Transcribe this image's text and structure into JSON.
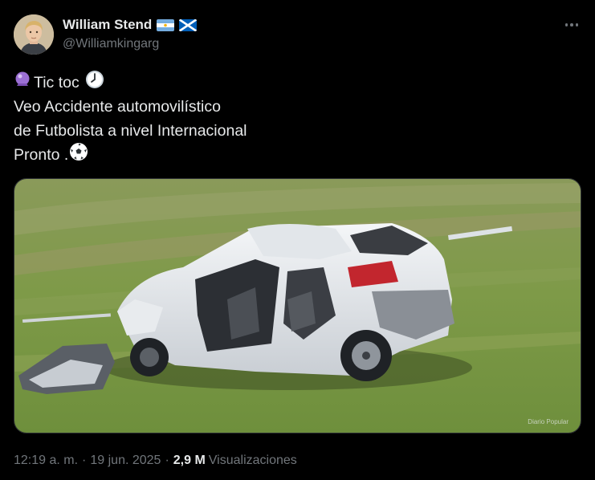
{
  "author": {
    "display_name": "William Stend",
    "handle": "@Williamkingarg",
    "flags": [
      "argentina-flag",
      "scotland-flag"
    ]
  },
  "tweet": {
    "lines": [
      {
        "prefix_icon": "crystal-ball-icon",
        "text": "Tic toc",
        "suffix_icon": "clock-icon"
      },
      {
        "text": "Veo Accidente automovilístico"
      },
      {
        "text": "de Futbolista a nivel Internacional"
      },
      {
        "text": "Pronto .",
        "suffix_icon": "soccer-ball-icon"
      }
    ]
  },
  "media": {
    "alt": "photo-of-wrecked-white-car-on-grass",
    "watermark": "Diario Popular"
  },
  "meta": {
    "time": "12:19 a. m.",
    "separator": "·",
    "date": "19 jun. 2025",
    "views_count": "2,9 M",
    "views_label": "Visualizaciones"
  },
  "colors": {
    "background": "#000000",
    "text_primary": "#e7e9ea",
    "text_secondary": "#71767b",
    "border": "#2f3336"
  }
}
